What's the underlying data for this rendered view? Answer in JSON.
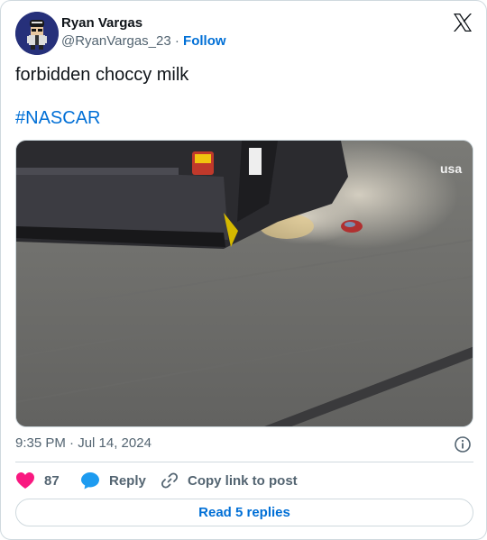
{
  "author": {
    "display_name": "Ryan Vargas",
    "handle": "@RyanVargas_23",
    "separator": "·",
    "follow_label": "Follow",
    "avatar_icon": "racer-character-avatar",
    "avatar_bg": "#26307a"
  },
  "platform": {
    "logo_icon": "x-logo-icon"
  },
  "tweet": {
    "text": "forbidden choccy milk",
    "hashtag": "#NASCAR"
  },
  "media": {
    "type": "video-still",
    "description_icon": "race-car-on-track-image",
    "network_logo": "usa"
  },
  "meta": {
    "timestamp": "9:35 PM · Jul 14, 2024",
    "info_icon": "info-icon"
  },
  "actions": {
    "like_count": "87",
    "reply_label": "Reply",
    "copy_label": "Copy link to post",
    "read_replies_label": "Read 5 replies"
  },
  "colors": {
    "link": "#006fd6",
    "like": "#f91880",
    "reply_icon": "#1d9bf0",
    "muted": "#536471",
    "border": "#cfd9de"
  }
}
